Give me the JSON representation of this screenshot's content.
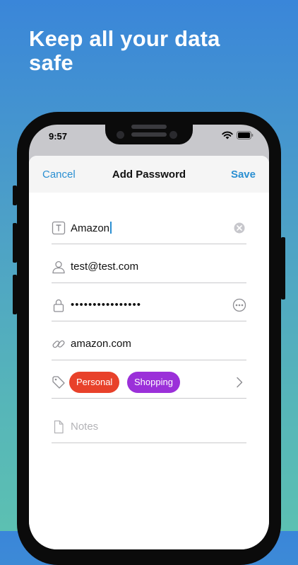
{
  "headline": "Keep all your data safe",
  "status_bar": {
    "time": "9:57"
  },
  "nav": {
    "cancel": "Cancel",
    "title": "Add Password",
    "save": "Save"
  },
  "fields": {
    "title": {
      "value": "Amazon",
      "icon": "text-box-icon"
    },
    "username": {
      "value": "test@test.com",
      "icon": "person-icon"
    },
    "password": {
      "value": "••••••••••••••••",
      "icon": "lock-icon"
    },
    "website": {
      "value": "amazon.com",
      "icon": "link-icon"
    },
    "notes": {
      "placeholder": "Notes",
      "icon": "document-icon"
    }
  },
  "tags": [
    {
      "label": "Personal",
      "color": "#e8412a"
    },
    {
      "label": "Shopping",
      "color": "#9b30d9"
    }
  ],
  "colors": {
    "accent": "#2a8fd2",
    "background_top": "#3a86d9",
    "background_bottom": "#5cc0b2"
  }
}
